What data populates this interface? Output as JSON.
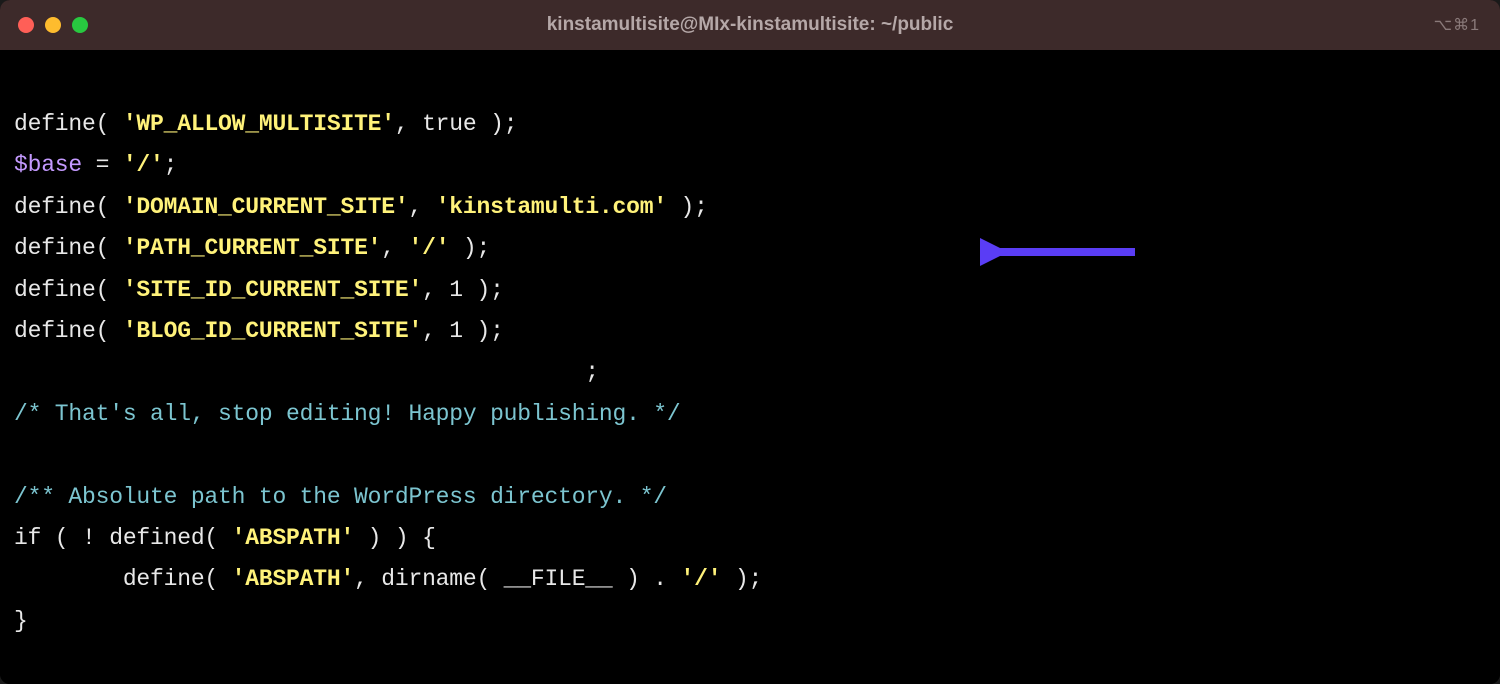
{
  "titlebar": {
    "title": "kinstamultisite@MIx-kinstamultisite: ~/public",
    "shortcut": "⌥⌘1"
  },
  "code": {
    "l1_define": "define( ",
    "l1_str": "'WP_ALLOW_MULTISITE'",
    "l1_rest": ", true );",
    "l2_var": "$base",
    "l2_eq": " = ",
    "l2_str": "'/'",
    "l2_end": ";",
    "l3_define": "define( ",
    "l3_str1": "'DOMAIN_CURRENT_SITE'",
    "l3_comma": ", ",
    "l3_str2": "'kinstamulti.com'",
    "l3_end": " );",
    "l4_define": "define( ",
    "l4_str1": "'PATH_CURRENT_SITE'",
    "l4_comma": ", ",
    "l4_str2": "'/'",
    "l4_end": " );",
    "l5_define": "define( ",
    "l5_str": "'SITE_ID_CURRENT_SITE'",
    "l5_rest": ", 1 );",
    "l6_define": "define( ",
    "l6_str": "'BLOG_ID_CURRENT_SITE'",
    "l6_rest": ", 1 );",
    "l7_pad": "                                          ",
    "l7_semi": ";",
    "l8_comment": "/* That's all, stop editing! Happy publishing. */",
    "l9_comment": "/** Absolute path to the WordPress directory. */",
    "l10_if": "if ( ! defined( ",
    "l10_str": "'ABSPATH'",
    "l10_rest": " ) ) {",
    "l11_pad": "        define( ",
    "l11_str1": "'ABSPATH'",
    "l11_mid": ", dirname( __FILE__ ) . ",
    "l11_str2": "'/'",
    "l11_end": " );",
    "l12": "}"
  }
}
